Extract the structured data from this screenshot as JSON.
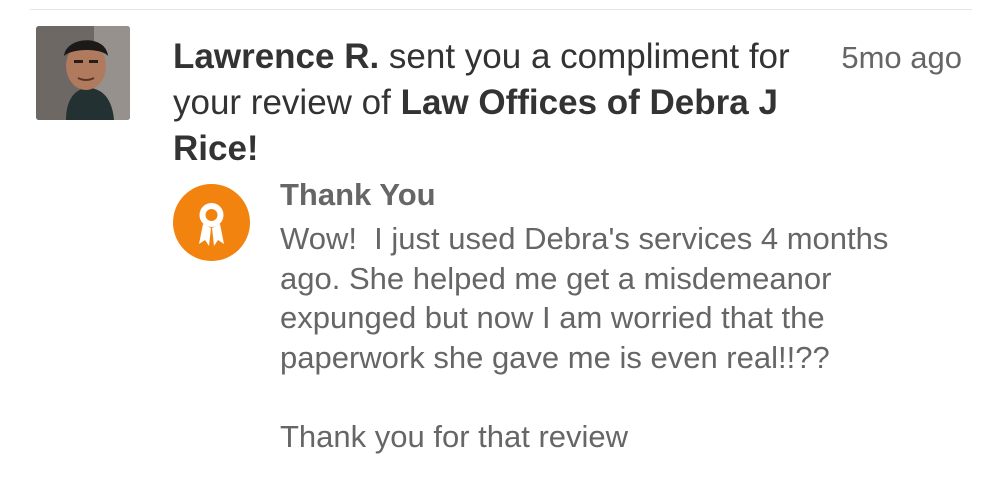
{
  "notification": {
    "sender_name": "Lawrence R.",
    "action_text": " sent you a compliment for your review of ",
    "business_name": "Law Offices of Debra J Rice!",
    "time_ago": "5mo ago",
    "avatar_icon": "user-avatar-photo"
  },
  "compliment": {
    "badge_icon": "award-ribbon-icon",
    "badge_color": "#f2830e",
    "title": "Thank You",
    "lines": [
      "Wow!  I just used Debra's services 4 months",
      "ago. She helped me get a misdemeanor",
      "expunged but now I am worried that the",
      "paperwork she gave me is even real!!??"
    ],
    "closing": "Thank you for that review"
  }
}
